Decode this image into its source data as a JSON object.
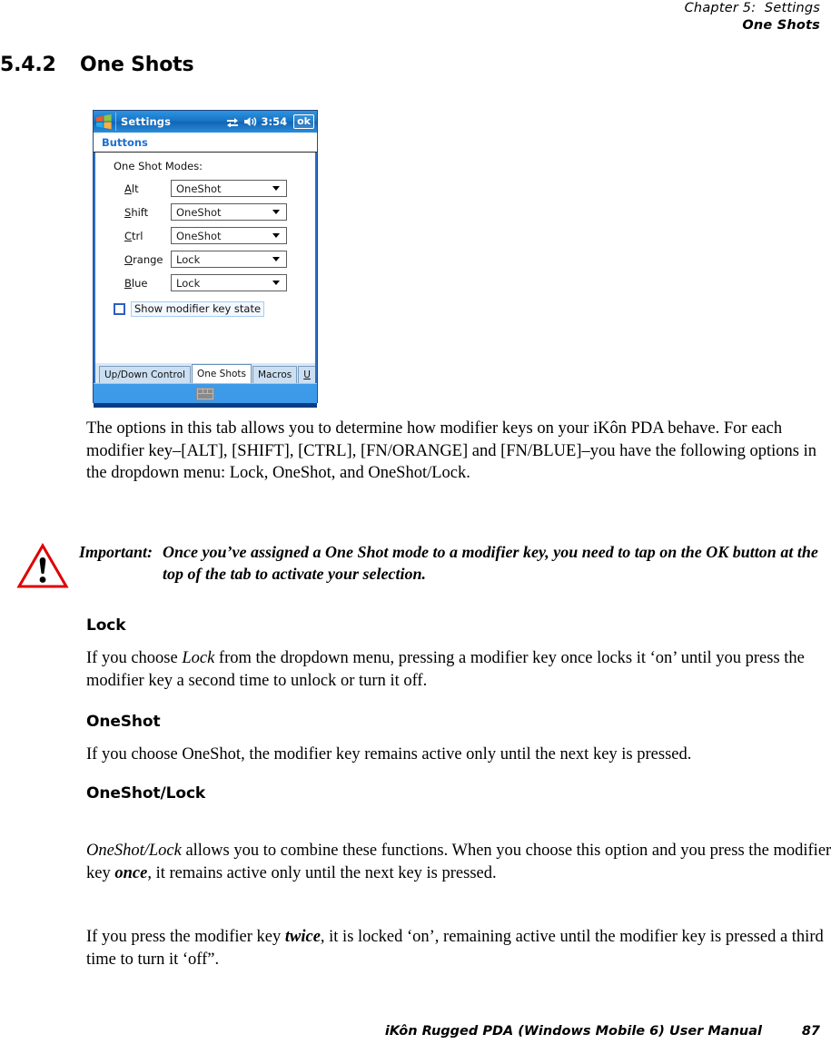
{
  "running_head": {
    "line1": "Chapter 5:  Settings",
    "line2": "One Shots"
  },
  "section": {
    "number": "5.4.2",
    "title": "One Shots"
  },
  "pda": {
    "titlebar": {
      "app_title": "Settings",
      "clock": "3:54",
      "ok_label": "ok",
      "icons": [
        "windows-flag-icon",
        "connectivity-icon",
        "speaker-icon"
      ]
    },
    "subheader": "Buttons",
    "group_label": "One Shot Modes:",
    "fields": [
      {
        "label": "Alt",
        "accel": "A",
        "rest": "lt",
        "value": "OneShot"
      },
      {
        "label": "Shift",
        "accel": "S",
        "rest": "hift",
        "value": "OneShot"
      },
      {
        "label": "Ctrl",
        "accel": "C",
        "rest": "trl",
        "value": "OneShot"
      },
      {
        "label": "Orange",
        "accel": "O",
        "rest": "range",
        "value": "Lock"
      },
      {
        "label": "Blue",
        "accel": "B",
        "rest": "lue",
        "value": "Lock"
      }
    ],
    "checkbox": {
      "label": "Show modifier key state",
      "checked": false
    },
    "tabs": [
      {
        "label": "Up/Down Control",
        "active": false
      },
      {
        "label": "One Shots",
        "active": true
      },
      {
        "label": "Macros",
        "active": false
      },
      {
        "label": "U",
        "active": false,
        "truncated": true
      }
    ],
    "tab_scroll": {
      "left": "◀",
      "right": "▶"
    },
    "sip_icon": "keyboard-icon",
    "colors": {
      "titlebar_blue": "#1673c4",
      "accent_blue": "#1f6fd0",
      "frame_blue": "#2d6fc4",
      "sip_blue": "#3d9ae8",
      "bottom_blue": "#0a3c86"
    }
  },
  "paragraphs": {
    "intro": "The options in this tab allows you to determine how modifier keys on your iKôn PDA behave. For each modifier key–[ALT], [SHIFT], [CTRL], [FN/ORANGE] and [FN/BLUE]–you have the following options in the dropdown menu: Lock, OneShot, and OneShot/Lock."
  },
  "callout": {
    "icon": "warning-triangle-icon",
    "label": "Important:",
    "text": "Once you’ve assigned a One Shot mode to a modifier key, you need to tap on the OK button at the top of the tab to activate your selection.",
    "color": "#e00000"
  },
  "sections": [
    {
      "heading": "Lock",
      "parts": [
        {
          "text": "If you choose ",
          "style": "normal"
        },
        {
          "text": "Lock",
          "style": "italic"
        },
        {
          "text": " from the dropdown menu, pressing a modifier key once locks it ‘on’ until you press the modifier key a second time to unlock or turn it off.",
          "style": "normal"
        }
      ]
    },
    {
      "heading": "OneShot",
      "parts": [
        {
          "text": "If you choose OneShot, the modifier key remains active only until the next key is pressed.",
          "style": "normal"
        }
      ]
    },
    {
      "heading": "OneShot/Lock",
      "parts": [
        {
          "text": "OneShot/Lock",
          "style": "italic"
        },
        {
          "text": " allows you to combine these functions. When you choose this option and you press the modifier key ",
          "style": "normal"
        },
        {
          "text": "once",
          "style": "bold-italic"
        },
        {
          "text": ", it remains active only until the next key is pressed.",
          "style": "normal"
        }
      ],
      "parts2": [
        {
          "text": "If you press the modifier key ",
          "style": "normal"
        },
        {
          "text": "twice",
          "style": "bold-italic"
        },
        {
          "text": ", it is locked ‘on’, remaining active until the modifier key is pressed a third time to turn it ‘off”.",
          "style": "normal"
        }
      ]
    }
  ],
  "footer": {
    "title": "iKôn Rugged PDA (Windows Mobile 6) User Manual",
    "page": "87"
  }
}
